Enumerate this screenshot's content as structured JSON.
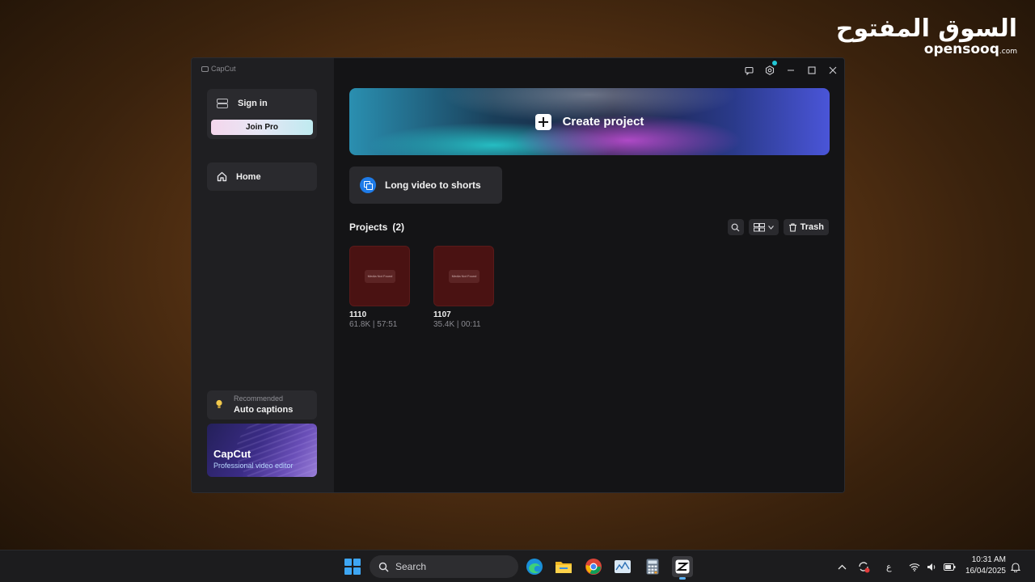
{
  "watermark": {
    "arabic": "السوق المفتوح",
    "latin": "opensooq",
    "suffix": ".com"
  },
  "app": {
    "brand": "CapCut",
    "sidebar": {
      "sign_in": "Sign in",
      "join_pro": "Join Pro",
      "home": "Home",
      "recommended_label": "Recommended",
      "recommended_title": "Auto captions",
      "promo_title": "CapCut",
      "promo_subtitle": "Professional video editor"
    },
    "main": {
      "create_project": "Create project",
      "long_video_to_shorts": "Long video to shorts",
      "projects_label": "Projects",
      "projects_count": "(2)",
      "trash": "Trash",
      "projects": [
        {
          "name": "1110",
          "meta": "61.8K | 57:51",
          "thumb_text": "Media Not Found"
        },
        {
          "name": "1107",
          "meta": "35.4K | 00:11",
          "thumb_text": "Media Not Found"
        }
      ]
    }
  },
  "taskbar": {
    "search_placeholder": "Search",
    "language": "ع",
    "time": "10:31 AM",
    "date": "16/04/2025"
  },
  "colors": {
    "accent": "#22c7d6",
    "join_pro_gradient": [
      "#f4d6ec",
      "#bfeaf0"
    ],
    "thumb_bg": "#4a1212"
  }
}
